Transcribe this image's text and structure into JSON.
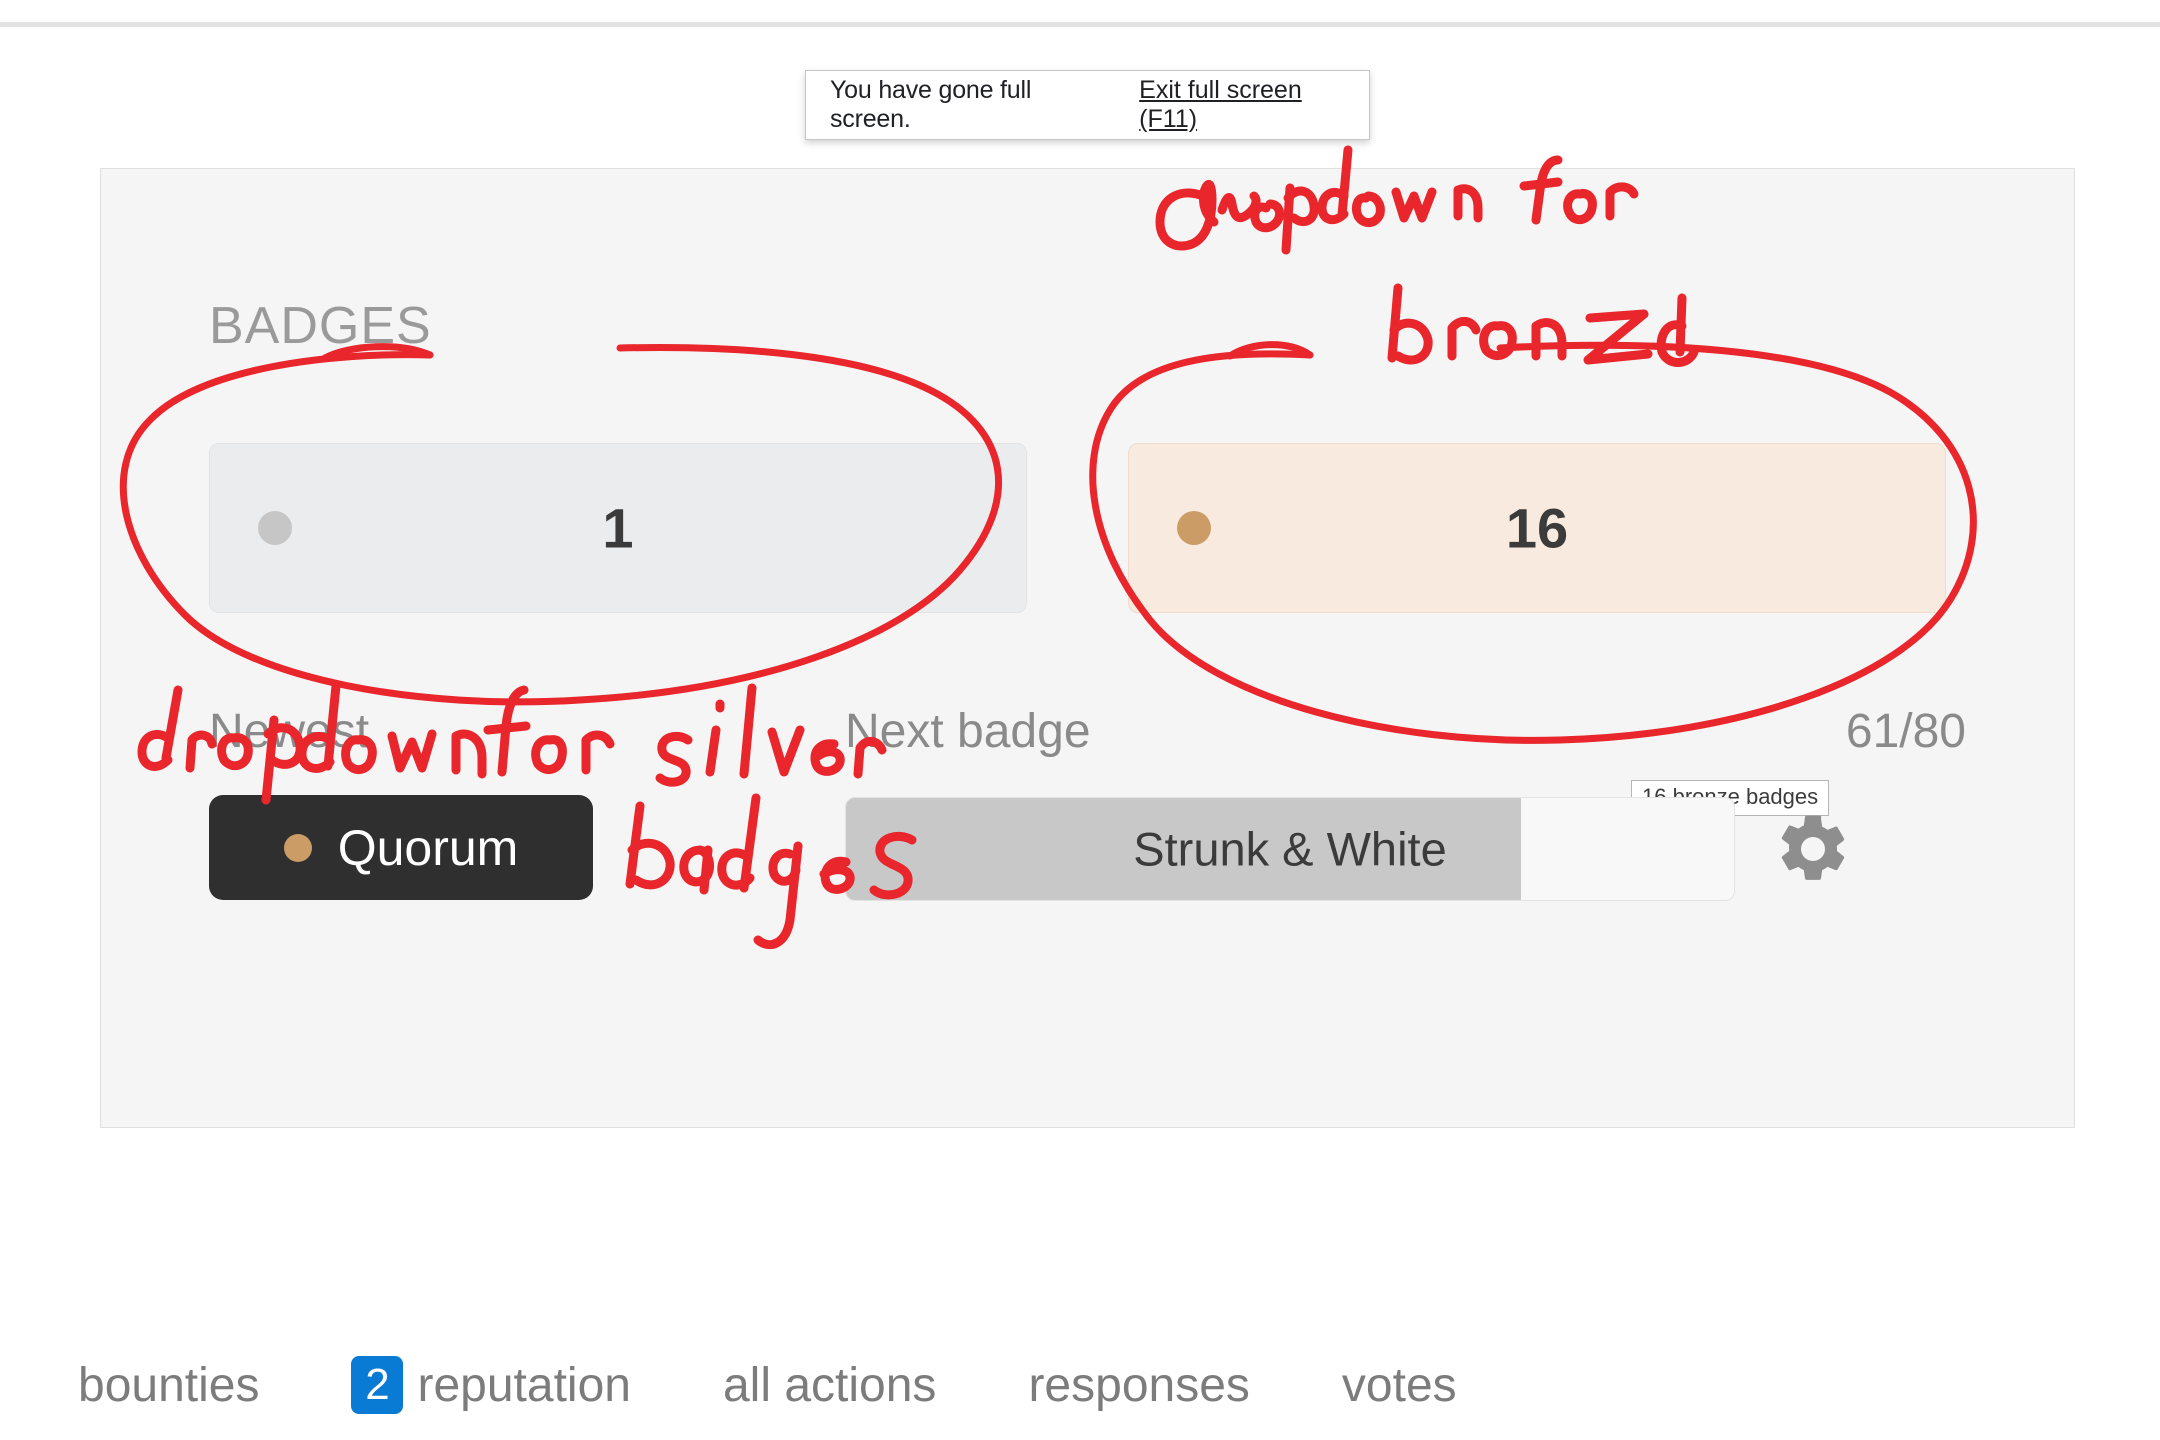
{
  "browser_notice": {
    "message": "You have gone full screen.",
    "exit_label": "Exit full screen (F11)"
  },
  "badges_card": {
    "title": "BADGES",
    "silver": {
      "count": "1",
      "dot_color": "#c6c6c6",
      "background": "#eaecee"
    },
    "bronze": {
      "count": "16",
      "dot_color": "#cb9c65",
      "background": "#f8eade",
      "tooltip": "16 bronze badges"
    },
    "newest": {
      "label": "Newest",
      "badge_name": "Quorum",
      "badge_dot_color": "#cb9c65",
      "badge_background": "#2f2f2f"
    },
    "next_badge": {
      "label": "Next badge",
      "progress_text": "61/80",
      "name": "Strunk & White",
      "progress_percent": 76,
      "fill_color": "#c8c8c8"
    },
    "settings_icon": "gear-icon"
  },
  "annotations": [
    {
      "id": "silver-note",
      "text": "dropdown for silver badges",
      "color": "#e8262b"
    },
    {
      "id": "bronze-note",
      "text": "dropdown for bronze",
      "color": "#e8262b"
    }
  ],
  "bottom_nav": {
    "items": [
      {
        "label": "bounties",
        "count": null
      },
      {
        "label": "reputation",
        "count": "2"
      },
      {
        "label": "all actions",
        "count": null
      },
      {
        "label": "responses",
        "count": null
      },
      {
        "label": "votes",
        "count": null
      }
    ],
    "count_badge_color": "#0a7bd4"
  }
}
